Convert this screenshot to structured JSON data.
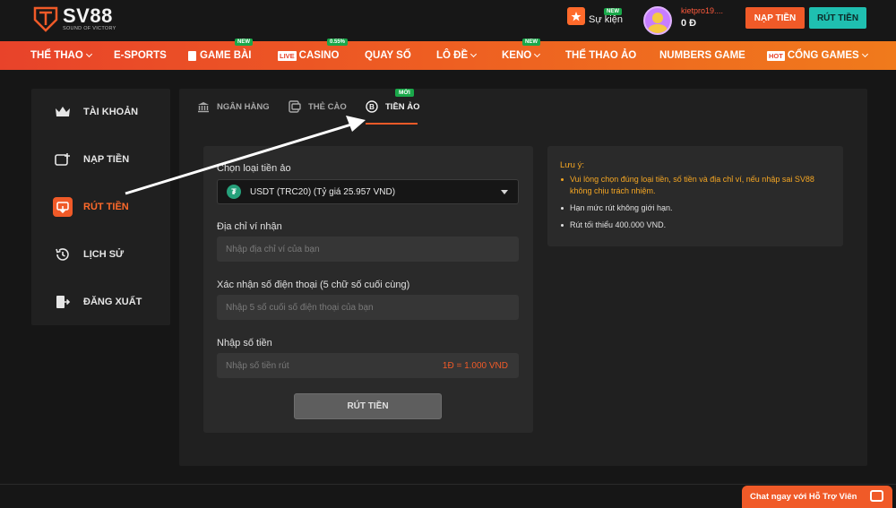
{
  "header": {
    "logo_text": "SV88",
    "logo_tagline": "SOUND OF VICTORY",
    "event_badge": "NEW",
    "event_label": "Sự kiện",
    "username": "kietpro19....",
    "balance": "0 Đ",
    "deposit_label": "NẠP TIỀN",
    "withdraw_label": "RÚT TIỀN"
  },
  "nav": {
    "items": [
      {
        "label": "THỂ THAO",
        "dropdown": true
      },
      {
        "label": "E-SPORTS"
      },
      {
        "label": "GAME BÀI",
        "badge": "NEW"
      },
      {
        "label": "CASINO",
        "tag": "LIVE",
        "badge": "0.55%"
      },
      {
        "label": "QUAY SỐ"
      },
      {
        "label": "LÔ ĐỀ",
        "dropdown": true
      },
      {
        "label": "KENO",
        "badge": "NEW",
        "dropdown": true
      },
      {
        "label": "THỂ THAO ẢO"
      },
      {
        "label": "NUMBERS GAME"
      },
      {
        "label": "CỔNG GAMES",
        "tag": "HOT",
        "dropdown": true
      }
    ]
  },
  "sidebar": {
    "items": [
      {
        "label": "TÀI KHOẢN",
        "icon": "crown-icon"
      },
      {
        "label": "NẠP TIỀN",
        "icon": "wallet-plus-icon"
      },
      {
        "label": "RÚT TIỀN",
        "icon": "withdraw-icon",
        "active": true
      },
      {
        "label": "LỊCH SỬ",
        "icon": "history-icon"
      },
      {
        "label": "ĐĂNG XUẤT",
        "icon": "logout-icon"
      }
    ]
  },
  "tabs": {
    "items": [
      {
        "label": "NGÂN HÀNG",
        "icon": "bank-icon"
      },
      {
        "label": "THẺ CÀO",
        "icon": "card-icon"
      },
      {
        "label": "TIỀN ẢO",
        "icon": "bitcoin-icon",
        "active": true
      }
    ],
    "new_badge": "MỚI"
  },
  "form": {
    "currency_label": "Chọn loại tiền ảo",
    "currency_value": "USDT (TRC20) (Tỷ giá 25.957 VND)",
    "wallet_label": "Địa chỉ ví nhận",
    "wallet_placeholder": "Nhập địa chỉ ví của bạn",
    "phone_label": "Xác nhận số điện thoại (5 chữ số cuối cùng)",
    "phone_placeholder": "Nhập 5 số cuối số điện thoại của bạn",
    "amount_label": "Nhập số tiền",
    "amount_placeholder": "Nhập số tiền rút",
    "rate_hint": "1Đ = 1.000 VND",
    "submit_label": "RÚT TIỀN"
  },
  "note": {
    "title": "Lưu ý:",
    "items": [
      "Vui lòng chọn đúng loại tiền, số tiền và địa chỉ ví, nếu nhập sai SV88 không chịu trách nhiệm.",
      "Hạn mức rút không giới hạn.",
      "Rút tối thiểu 400.000 VND."
    ]
  },
  "chat": {
    "label": "Chat ngay với Hỗ Trợ Viên"
  },
  "colors": {
    "accent": "#f05a28",
    "teal": "#1fbfb0",
    "new_badge": "#1aa84a",
    "warn": "#f5a623"
  }
}
